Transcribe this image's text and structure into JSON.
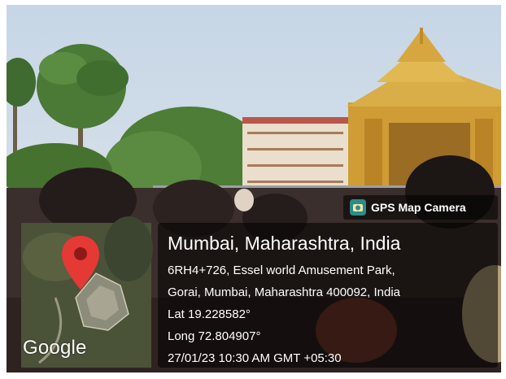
{
  "badge": {
    "label": "GPS Map Camera",
    "icon": "camera-icon"
  },
  "map": {
    "logo_text": "Google",
    "pin_icon": "map-pin-icon"
  },
  "location": {
    "title": "Mumbai, Maharashtra, India",
    "address_line1": "6RH4+726, Essel world Amusement Park,",
    "address_line2": "Gorai, Mumbai, Maharashtra 400092, India",
    "lat": "Lat 19.228582°",
    "long": "Long 72.804907°",
    "datetime": "27/01/23 10:30 AM GMT +05:30"
  },
  "colors": {
    "sky": "#c8d8e6",
    "temple_gold": "#d4a640",
    "building": "#e8dcc8",
    "pin_red": "#e53935",
    "overlay": "#000000"
  }
}
